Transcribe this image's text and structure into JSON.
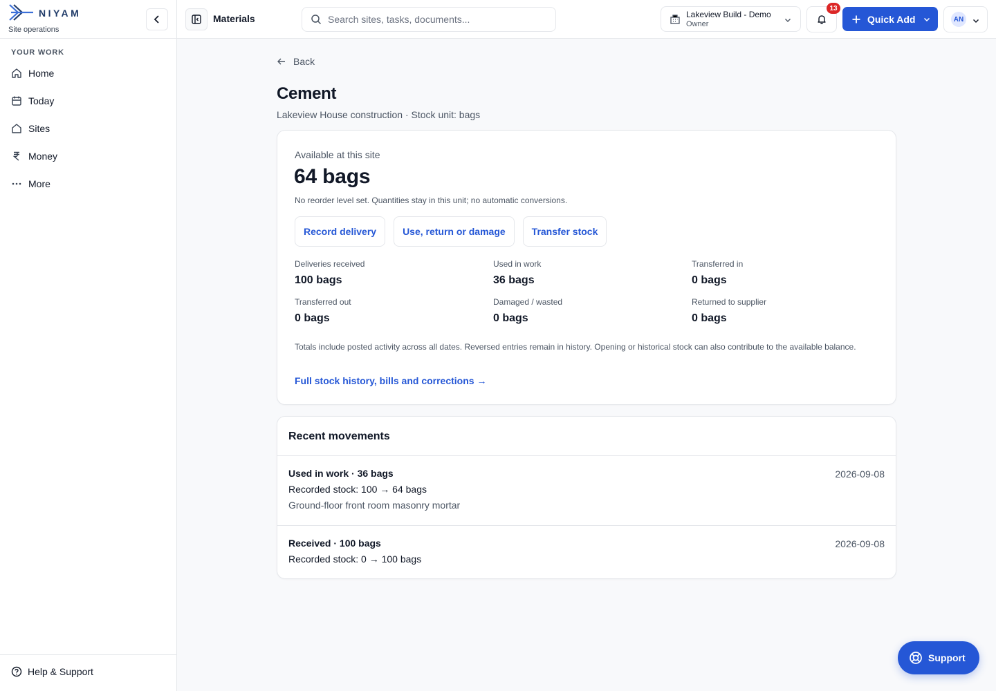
{
  "brand": {
    "name": "NIYAM",
    "tagline": "Site operations"
  },
  "sidebar": {
    "section_label": "YOUR WORK",
    "items": [
      {
        "label": "Home",
        "icon": "home-icon"
      },
      {
        "label": "Today",
        "icon": "calendar-icon"
      },
      {
        "label": "Sites",
        "icon": "building-icon"
      },
      {
        "label": "Money",
        "icon": "rupee-icon"
      },
      {
        "label": "More",
        "icon": "more-icon"
      }
    ],
    "footer_label": "Help & Support"
  },
  "topbar": {
    "page_name": "Materials",
    "search_placeholder": "Search sites, tasks, documents...",
    "project_name": "Lakeview Build - Demo",
    "project_role": "Owner",
    "notification_count": "13",
    "quick_add_label": "Quick Add",
    "user_initials": "AN"
  },
  "page": {
    "back_label": "Back",
    "title": "Cement",
    "subtitle": "Lakeview House construction · Stock unit: bags"
  },
  "stock": {
    "available_label": "Available at this site",
    "available_value": "64 bags",
    "note": "No reorder level set. Quantities stay in this unit; no automatic conversions.",
    "actions": [
      "Record delivery",
      "Use, return or damage",
      "Transfer stock"
    ],
    "stats": [
      {
        "label": "Deliveries received",
        "value": "100 bags"
      },
      {
        "label": "Used in work",
        "value": "36 bags"
      },
      {
        "label": "Transferred in",
        "value": "0 bags"
      },
      {
        "label": "Transferred out",
        "value": "0 bags"
      },
      {
        "label": "Damaged / wasted",
        "value": "0 bags"
      },
      {
        "label": "Returned to supplier",
        "value": "0 bags"
      }
    ],
    "totals_note": "Totals include posted activity across all dates. Reversed entries remain in history. Opening or historical stock can also contribute to the available balance.",
    "history_link": "Full stock history, bills and corrections →"
  },
  "movements": {
    "title": "Recent movements",
    "items": [
      {
        "title": "Used in work · 36 bags",
        "line": "Recorded stock: 100 → 64 bags",
        "note": "Ground-floor front room masonry mortar",
        "date": "2026-09-08"
      },
      {
        "title": "Received · 100 bags",
        "line": "Recorded stock: 0 → 100 bags",
        "date": "2026-09-08"
      }
    ]
  },
  "support_label": "Support",
  "colors": {
    "accent": "#2557d6",
    "badge": "#dc2626",
    "brand": "#1f3a68"
  }
}
